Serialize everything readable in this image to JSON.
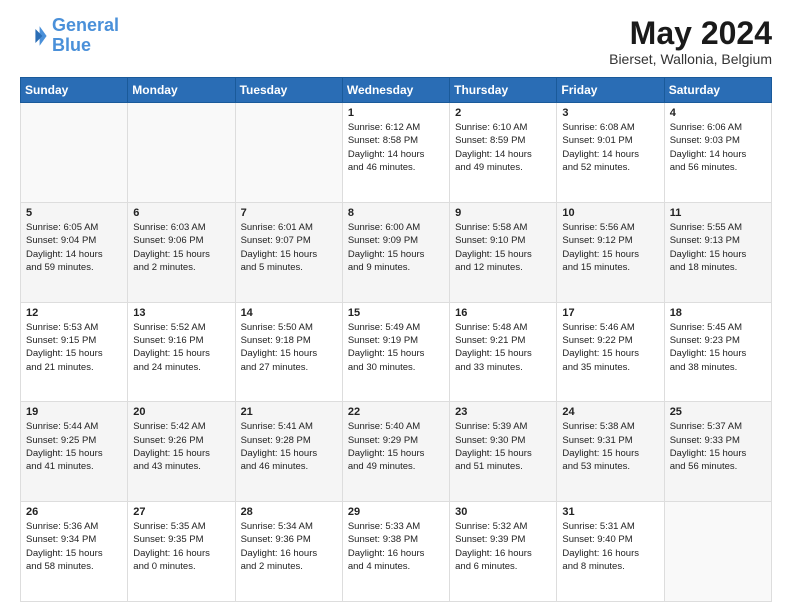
{
  "logo": {
    "line1": "General",
    "line2": "Blue"
  },
  "title": "May 2024",
  "location": "Bierset, Wallonia, Belgium",
  "days_header": [
    "Sunday",
    "Monday",
    "Tuesday",
    "Wednesday",
    "Thursday",
    "Friday",
    "Saturday"
  ],
  "weeks": [
    [
      {
        "day": "",
        "content": ""
      },
      {
        "day": "",
        "content": ""
      },
      {
        "day": "",
        "content": ""
      },
      {
        "day": "1",
        "content": "Sunrise: 6:12 AM\nSunset: 8:58 PM\nDaylight: 14 hours\nand 46 minutes."
      },
      {
        "day": "2",
        "content": "Sunrise: 6:10 AM\nSunset: 8:59 PM\nDaylight: 14 hours\nand 49 minutes."
      },
      {
        "day": "3",
        "content": "Sunrise: 6:08 AM\nSunset: 9:01 PM\nDaylight: 14 hours\nand 52 minutes."
      },
      {
        "day": "4",
        "content": "Sunrise: 6:06 AM\nSunset: 9:03 PM\nDaylight: 14 hours\nand 56 minutes."
      }
    ],
    [
      {
        "day": "5",
        "content": "Sunrise: 6:05 AM\nSunset: 9:04 PM\nDaylight: 14 hours\nand 59 minutes."
      },
      {
        "day": "6",
        "content": "Sunrise: 6:03 AM\nSunset: 9:06 PM\nDaylight: 15 hours\nand 2 minutes."
      },
      {
        "day": "7",
        "content": "Sunrise: 6:01 AM\nSunset: 9:07 PM\nDaylight: 15 hours\nand 5 minutes."
      },
      {
        "day": "8",
        "content": "Sunrise: 6:00 AM\nSunset: 9:09 PM\nDaylight: 15 hours\nand 9 minutes."
      },
      {
        "day": "9",
        "content": "Sunrise: 5:58 AM\nSunset: 9:10 PM\nDaylight: 15 hours\nand 12 minutes."
      },
      {
        "day": "10",
        "content": "Sunrise: 5:56 AM\nSunset: 9:12 PM\nDaylight: 15 hours\nand 15 minutes."
      },
      {
        "day": "11",
        "content": "Sunrise: 5:55 AM\nSunset: 9:13 PM\nDaylight: 15 hours\nand 18 minutes."
      }
    ],
    [
      {
        "day": "12",
        "content": "Sunrise: 5:53 AM\nSunset: 9:15 PM\nDaylight: 15 hours\nand 21 minutes."
      },
      {
        "day": "13",
        "content": "Sunrise: 5:52 AM\nSunset: 9:16 PM\nDaylight: 15 hours\nand 24 minutes."
      },
      {
        "day": "14",
        "content": "Sunrise: 5:50 AM\nSunset: 9:18 PM\nDaylight: 15 hours\nand 27 minutes."
      },
      {
        "day": "15",
        "content": "Sunrise: 5:49 AM\nSunset: 9:19 PM\nDaylight: 15 hours\nand 30 minutes."
      },
      {
        "day": "16",
        "content": "Sunrise: 5:48 AM\nSunset: 9:21 PM\nDaylight: 15 hours\nand 33 minutes."
      },
      {
        "day": "17",
        "content": "Sunrise: 5:46 AM\nSunset: 9:22 PM\nDaylight: 15 hours\nand 35 minutes."
      },
      {
        "day": "18",
        "content": "Sunrise: 5:45 AM\nSunset: 9:23 PM\nDaylight: 15 hours\nand 38 minutes."
      }
    ],
    [
      {
        "day": "19",
        "content": "Sunrise: 5:44 AM\nSunset: 9:25 PM\nDaylight: 15 hours\nand 41 minutes."
      },
      {
        "day": "20",
        "content": "Sunrise: 5:42 AM\nSunset: 9:26 PM\nDaylight: 15 hours\nand 43 minutes."
      },
      {
        "day": "21",
        "content": "Sunrise: 5:41 AM\nSunset: 9:28 PM\nDaylight: 15 hours\nand 46 minutes."
      },
      {
        "day": "22",
        "content": "Sunrise: 5:40 AM\nSunset: 9:29 PM\nDaylight: 15 hours\nand 49 minutes."
      },
      {
        "day": "23",
        "content": "Sunrise: 5:39 AM\nSunset: 9:30 PM\nDaylight: 15 hours\nand 51 minutes."
      },
      {
        "day": "24",
        "content": "Sunrise: 5:38 AM\nSunset: 9:31 PM\nDaylight: 15 hours\nand 53 minutes."
      },
      {
        "day": "25",
        "content": "Sunrise: 5:37 AM\nSunset: 9:33 PM\nDaylight: 15 hours\nand 56 minutes."
      }
    ],
    [
      {
        "day": "26",
        "content": "Sunrise: 5:36 AM\nSunset: 9:34 PM\nDaylight: 15 hours\nand 58 minutes."
      },
      {
        "day": "27",
        "content": "Sunrise: 5:35 AM\nSunset: 9:35 PM\nDaylight: 16 hours\nand 0 minutes."
      },
      {
        "day": "28",
        "content": "Sunrise: 5:34 AM\nSunset: 9:36 PM\nDaylight: 16 hours\nand 2 minutes."
      },
      {
        "day": "29",
        "content": "Sunrise: 5:33 AM\nSunset: 9:38 PM\nDaylight: 16 hours\nand 4 minutes."
      },
      {
        "day": "30",
        "content": "Sunrise: 5:32 AM\nSunset: 9:39 PM\nDaylight: 16 hours\nand 6 minutes."
      },
      {
        "day": "31",
        "content": "Sunrise: 5:31 AM\nSunset: 9:40 PM\nDaylight: 16 hours\nand 8 minutes."
      },
      {
        "day": "",
        "content": ""
      }
    ]
  ]
}
